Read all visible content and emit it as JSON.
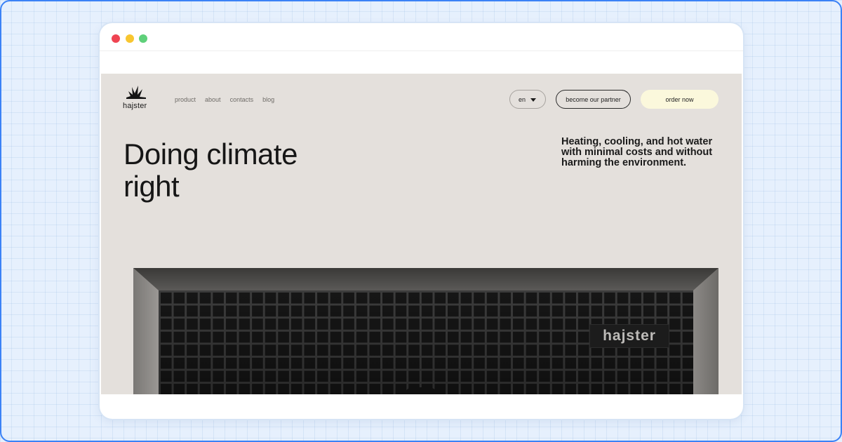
{
  "brand": {
    "name": "hajster",
    "device_label": "hajster"
  },
  "nav": {
    "items": [
      {
        "label": "product"
      },
      {
        "label": "about"
      },
      {
        "label": "contacts"
      },
      {
        "label": "blog"
      }
    ]
  },
  "header_actions": {
    "language": "en",
    "partner_label": "become our partner",
    "order_label": "order now"
  },
  "hero": {
    "headline": "Doing climate right",
    "subheadline": "Heating, cooling, and hot water with minimal costs and without harming the environment."
  },
  "icons": {
    "language_caret": "chevron-down-icon",
    "scroll": "arrow-down-icon",
    "logo": "bird-wing-icon"
  },
  "colors": {
    "page_background": "#e4e0dc",
    "order_button": "#fbf8dc",
    "window_dot_red": "#ef4452",
    "window_dot_yellow": "#f8c630",
    "window_dot_green": "#5fd07a"
  }
}
